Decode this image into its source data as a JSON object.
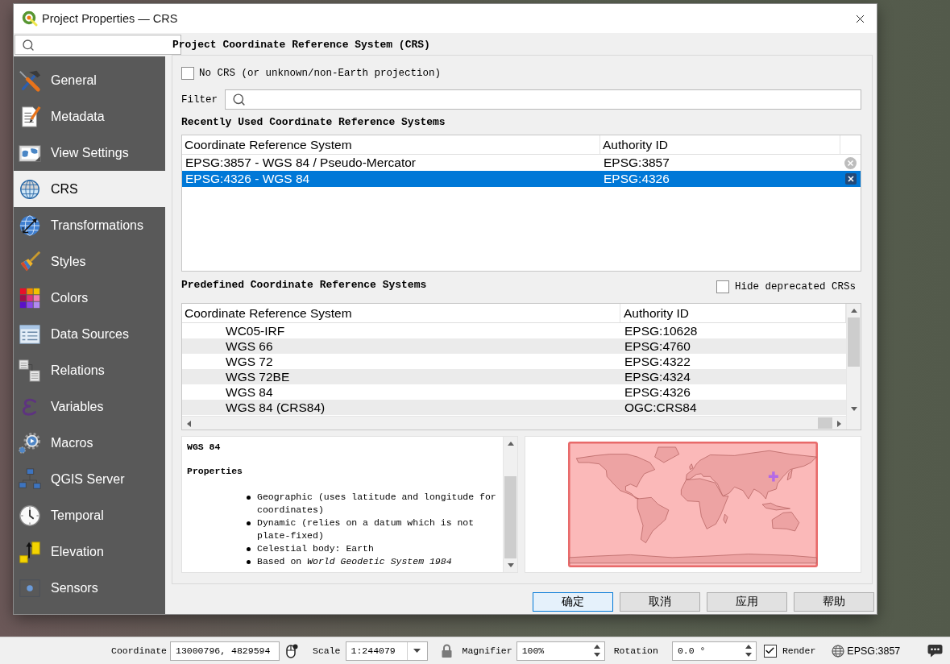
{
  "window": {
    "title": "Project Properties — CRS"
  },
  "sidebar": {
    "items": [
      {
        "label": "General",
        "selected": false
      },
      {
        "label": "Metadata",
        "selected": false
      },
      {
        "label": "View Settings",
        "selected": false
      },
      {
        "label": "CRS",
        "selected": true
      },
      {
        "label": "Transformations",
        "selected": false
      },
      {
        "label": "Styles",
        "selected": false
      },
      {
        "label": "Colors",
        "selected": false
      },
      {
        "label": "Data Sources",
        "selected": false
      },
      {
        "label": "Relations",
        "selected": false
      },
      {
        "label": "Variables",
        "selected": false
      },
      {
        "label": "Macros",
        "selected": false
      },
      {
        "label": "QGIS Server",
        "selected": false
      },
      {
        "label": "Temporal",
        "selected": false
      },
      {
        "label": "Elevation",
        "selected": false
      },
      {
        "label": "Sensors",
        "selected": false
      }
    ]
  },
  "crs_page": {
    "heading": "Project Coordinate Reference System (CRS)",
    "no_crs": {
      "label": "No CRS (or unknown/non-Earth projection)",
      "checked": false
    },
    "filter": {
      "label": "Filter"
    },
    "recent": {
      "title": "Recently Used Coordinate Reference Systems",
      "columns": [
        "Coordinate Reference System",
        "Authority ID"
      ],
      "rows": [
        {
          "crs": "EPSG:3857 - WGS 84 / Pseudo-Mercator",
          "authority_id": "EPSG:3857",
          "selected": false
        },
        {
          "crs": "EPSG:4326 - WGS 84",
          "authority_id": "EPSG:4326",
          "selected": true
        }
      ]
    },
    "predefined": {
      "title": "Predefined Coordinate Reference Systems",
      "hide_deprecated": {
        "label": "Hide deprecated CRSs",
        "checked": false
      },
      "columns": [
        "Coordinate Reference System",
        "Authority ID"
      ],
      "rows": [
        {
          "crs": "WC05-IRF",
          "authority_id": "EPSG:10628",
          "selected": false
        },
        {
          "crs": "WGS 66",
          "authority_id": "EPSG:4760",
          "selected": false
        },
        {
          "crs": "WGS 72",
          "authority_id": "EPSG:4322",
          "selected": false
        },
        {
          "crs": "WGS 72BE",
          "authority_id": "EPSG:4324",
          "selected": false
        },
        {
          "crs": "WGS 84",
          "authority_id": "EPSG:4326",
          "selected": false
        },
        {
          "crs": "WGS 84 (CRS84)",
          "authority_id": "OGC:CRS84",
          "selected": false
        }
      ]
    },
    "details": {
      "name": "WGS 84",
      "section": "Properties",
      "bullets": [
        "Geographic (uses latitude and longitude for coordinates)",
        "Dynamic (relies on a datum which is not plate-fixed)",
        "Celestial body: Earth",
        "Based on *World Geodetic System 1984*"
      ]
    }
  },
  "buttons": [
    {
      "label": "确定",
      "default": true
    },
    {
      "label": "取消",
      "default": false
    },
    {
      "label": "应用",
      "default": false
    },
    {
      "label": "帮助",
      "default": false
    }
  ],
  "status_bar": {
    "coordinate": {
      "label": "Coordinate",
      "value": "13000796, 4829594"
    },
    "scale": {
      "label": "Scale",
      "value": "1:244079"
    },
    "magnifier": {
      "label": "Magnifier",
      "value": "100%"
    },
    "rotation": {
      "label": "Rotation",
      "value": "0.0 °"
    },
    "render": {
      "label": "Render",
      "checked": true
    },
    "crs": "EPSG:3857"
  }
}
